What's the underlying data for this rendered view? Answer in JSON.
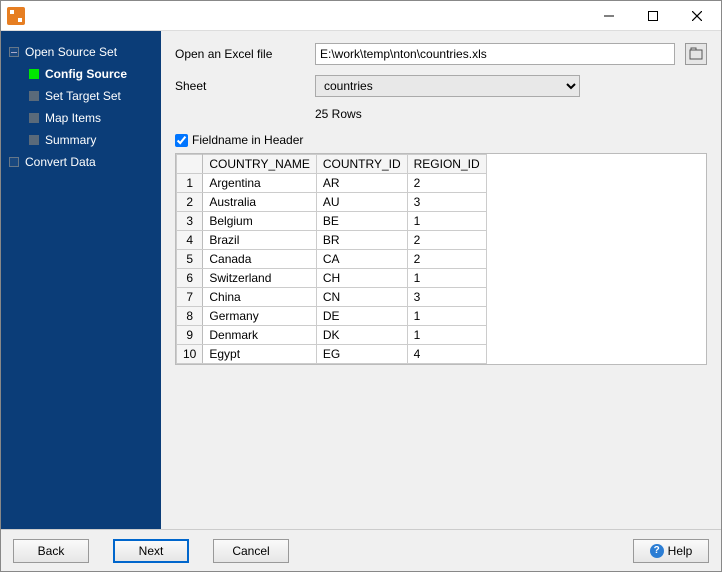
{
  "sidebar": {
    "items": [
      {
        "label": "Open Source Set"
      },
      {
        "label": "Config Source",
        "active": true
      },
      {
        "label": "Set Target Set"
      },
      {
        "label": "Map Items"
      },
      {
        "label": "Summary"
      },
      {
        "label": "Convert Data"
      }
    ]
  },
  "form": {
    "open_label": "Open an Excel file",
    "file_path": "E:\\work\\temp\\nton\\countries.xls",
    "sheet_label": "Sheet",
    "sheet_value": "countries",
    "row_count": "25 Rows",
    "fieldname_label": "Fieldname in Header",
    "fieldname_checked": true
  },
  "table": {
    "headers": [
      "COUNTRY_NAME",
      "COUNTRY_ID",
      "REGION_ID"
    ],
    "rows": [
      [
        "Argentina",
        "AR",
        "2"
      ],
      [
        "Australia",
        "AU",
        "3"
      ],
      [
        "Belgium",
        "BE",
        "1"
      ],
      [
        "Brazil",
        "BR",
        "2"
      ],
      [
        "Canada",
        "CA",
        "2"
      ],
      [
        "Switzerland",
        "CH",
        "1"
      ],
      [
        "China",
        "CN",
        "3"
      ],
      [
        "Germany",
        "DE",
        "1"
      ],
      [
        "Denmark",
        "DK",
        "1"
      ],
      [
        "Egypt",
        "EG",
        "4"
      ]
    ]
  },
  "buttons": {
    "back": "Back",
    "next": "Next",
    "cancel": "Cancel",
    "help": "Help"
  }
}
